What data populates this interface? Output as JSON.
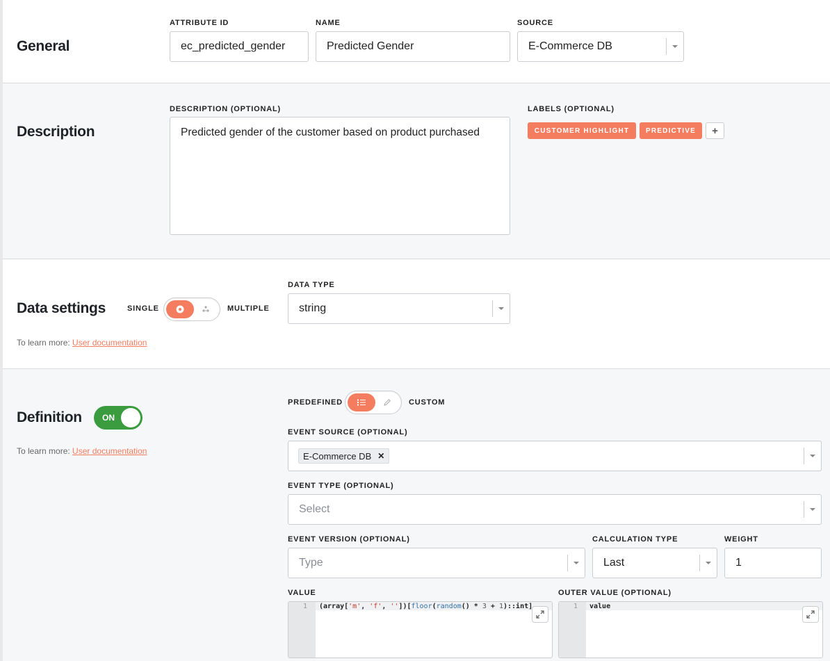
{
  "general": {
    "title": "General",
    "attribute_id_label": "ATTRIBUTE ID",
    "attribute_id_value": "ec_predicted_gender",
    "name_label": "NAME",
    "name_value": "Predicted Gender",
    "source_label": "SOURCE",
    "source_value": "E-Commerce DB"
  },
  "description": {
    "title": "Description",
    "desc_label": "DESCRIPTION (OPTIONAL)",
    "desc_value": "Predicted gender of the customer based on product purchased",
    "labels_label": "LABELS (OPTIONAL)",
    "tags": [
      "CUSTOMER HIGHLIGHT",
      "PREDICTIVE"
    ],
    "add_tag": "+"
  },
  "data_settings": {
    "title": "Data settings",
    "single_label": "SINGLE",
    "multiple_label": "MULTIPLE",
    "data_type_label": "DATA TYPE",
    "data_type_value": "string",
    "learn_prefix": "To learn more:",
    "learn_link": "User documentation"
  },
  "definition": {
    "title": "Definition",
    "toggle_label": "ON",
    "learn_prefix": "To learn more:",
    "learn_link": "User documentation",
    "predefined_label": "PREDEFINED",
    "custom_label": "CUSTOM",
    "event_source_label": "EVENT SOURCE (OPTIONAL)",
    "event_source_chip": "E-Commerce DB",
    "event_type_label": "EVENT TYPE (OPTIONAL)",
    "event_type_placeholder": "Select",
    "event_version_label": "EVENT VERSION (OPTIONAL)",
    "event_version_placeholder": "Type",
    "calc_type_label": "CALCULATION TYPE",
    "calc_type_value": "Last",
    "weight_label": "WEIGHT",
    "weight_value": "1",
    "value_label": "VALUE",
    "value_line_no": "1",
    "value_code": "(array['m', 'f', ''])[floor(random() * 3 + 1)::int]",
    "outer_value_label": "OUTER VALUE (OPTIONAL)",
    "outer_line_no": "1",
    "outer_code": "value"
  },
  "colors": {
    "accent": "#f47c5f",
    "toggle_on": "#3a9b3f",
    "section_alt_bg": "#f6f7f9"
  }
}
